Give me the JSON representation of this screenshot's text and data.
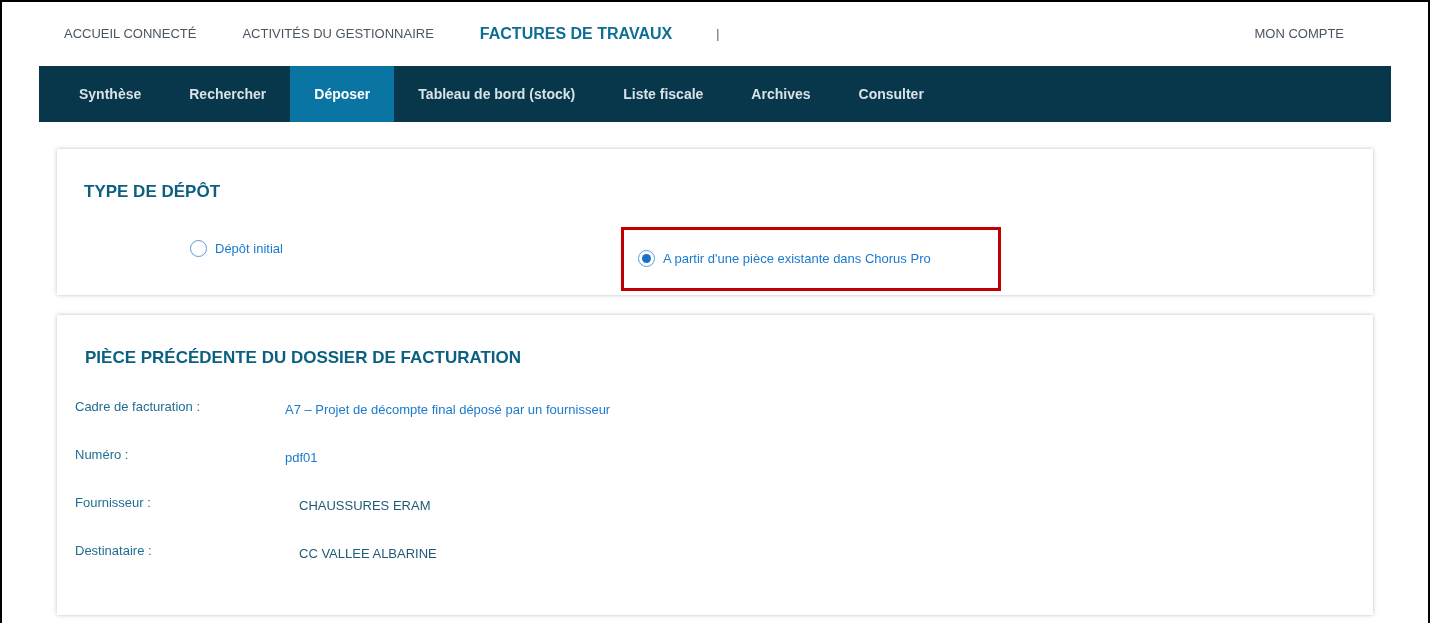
{
  "top_nav": [
    {
      "label": "ACCUEIL CONNECTÉ",
      "selected": false
    },
    {
      "label": "ACTIVITÉS DU GESTIONNAIRE",
      "selected": false
    },
    {
      "label": "FACTURES DE TRAVAUX",
      "selected": true
    }
  ],
  "top_nav_separator": "|",
  "account_link": "MON COMPTE",
  "tabs": [
    {
      "label": "Synthèse",
      "selected": false
    },
    {
      "label": "Rechercher",
      "selected": false
    },
    {
      "label": "Déposer",
      "selected": true
    },
    {
      "label": "Tableau de bord (stock)",
      "selected": false
    },
    {
      "label": "Liste fiscale",
      "selected": false
    },
    {
      "label": "Archives",
      "selected": false
    },
    {
      "label": "Consulter",
      "selected": false
    }
  ],
  "deposit_type": {
    "title": "TYPE DE DÉPÔT",
    "options": [
      {
        "label": "Dépôt initial",
        "selected": false,
        "highlighted": false
      },
      {
        "label": "A partir d'une pièce existante dans Chorus Pro",
        "selected": true,
        "highlighted": true
      }
    ]
  },
  "previous_piece": {
    "title": "PIÈCE PRÉCÉDENTE DU DOSSIER DE FACTURATION",
    "fields": [
      {
        "label": "Cadre de facturation :",
        "value": "A7 – Projet de décompte final déposé par un fournisseur",
        "kind": "link"
      },
      {
        "label": "Numéro :",
        "value": "pdf01",
        "kind": "link"
      },
      {
        "label": "Fournisseur :",
        "value": "CHAUSSURES ERAM",
        "kind": "text"
      },
      {
        "label": "Destinataire :",
        "value": "CC VALLEE ALBARINE",
        "kind": "text"
      }
    ]
  }
}
